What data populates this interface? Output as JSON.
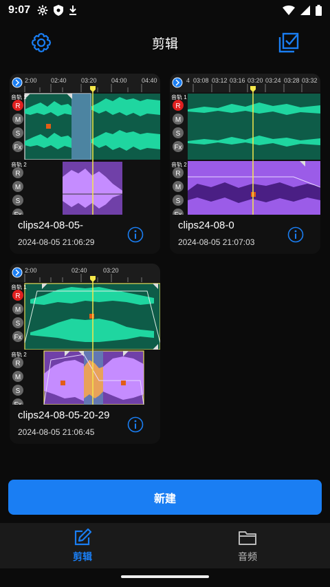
{
  "status_bar": {
    "time": "9:07",
    "left_icons": [
      "gear-icon",
      "shield-icon",
      "download-icon"
    ],
    "right_icons": [
      "wifi-icon",
      "signal-icon",
      "battery-icon"
    ]
  },
  "app_bar": {
    "title": "剪辑",
    "left_icon": "settings-icon",
    "right_icon": "multi-select-icon"
  },
  "colors": {
    "accent": "#1a7ef3",
    "green_wave": "#1fd6a0",
    "purple_wave": "#a35cf0",
    "playhead": "#f5e84a",
    "record": "#e02020"
  },
  "projects": [
    {
      "name": "clips24-08-05-",
      "date": "2024-08-05 21:06:29",
      "ruler": [
        "2:00",
        "02:40",
        "03:20",
        "04:00",
        "04:40"
      ],
      "track1_label": "音轨 1",
      "track2_label": "音轨 2",
      "buttons": [
        "R",
        "M",
        "S",
        "Fx"
      ]
    },
    {
      "name": "clips24-08-0",
      "date": "2024-08-05 21:07:03",
      "ruler": [
        "4",
        "03:08",
        "03:12",
        "03:16",
        "03:20",
        "03:24",
        "03:28",
        "03:32"
      ],
      "track1_label": "音轨 1",
      "track2_label": "音轨 2",
      "buttons": [
        "R",
        "M",
        "S",
        "Fx"
      ]
    },
    {
      "name": "clips24-08-05-20-29",
      "date": "2024-08-05 21:06:45",
      "ruler": [
        "2:00",
        "02:40",
        "03:20"
      ],
      "track1_label": "音轨 1",
      "track2_label": "音轨 2",
      "buttons": [
        "R",
        "M",
        "S",
        "Fx"
      ]
    }
  ],
  "new_button": "新建",
  "bottom_nav": [
    {
      "label": "剪辑",
      "icon": "edit-icon",
      "active": true
    },
    {
      "label": "音频",
      "icon": "folder-icon",
      "active": false
    }
  ]
}
